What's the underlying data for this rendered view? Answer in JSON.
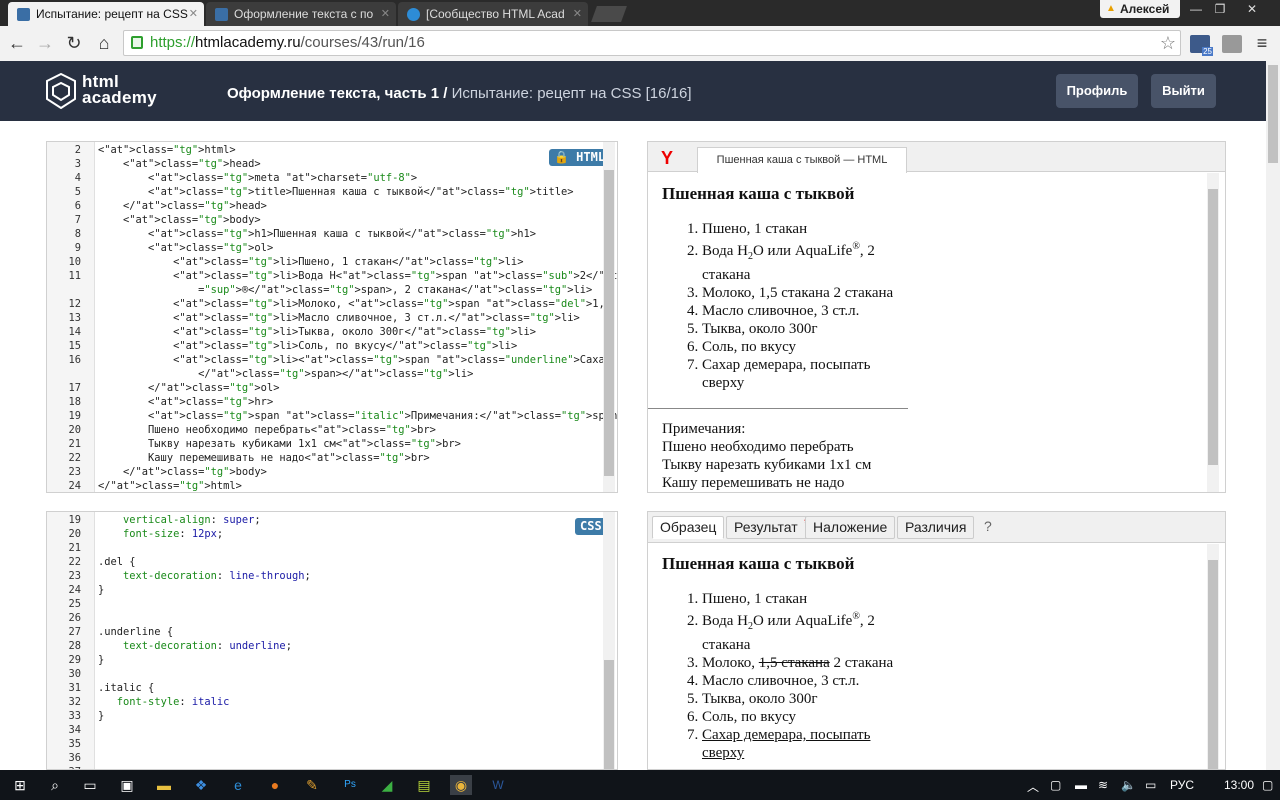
{
  "browser": {
    "tabs": [
      {
        "title": "Испытание: рецепт на CSS",
        "active": true
      },
      {
        "title": "Оформление текста с по",
        "active": false
      },
      {
        "title": "[Сообщество HTML Acad",
        "active": false
      }
    ],
    "user": "Алексей",
    "url_scheme": "https://",
    "url_host": "htmlacademy.ru",
    "url_path": "/courses/43/run/16",
    "mail_count": "25"
  },
  "header": {
    "logo_line1": "html",
    "logo_line2": "academy",
    "course": "Оформление текста, часть 1",
    "separator": "/",
    "task": "Испытание: рецепт на CSS",
    "progress": "[16/16]",
    "profile_label": "Профиль",
    "logout_label": "Выйти"
  },
  "html_editor": {
    "badge": "HTML",
    "lines": [
      {
        "n": "2",
        "code": "<html>"
      },
      {
        "n": "3",
        "code": "    <head>"
      },
      {
        "n": "4",
        "code": "        <meta charset=\"utf-8\">"
      },
      {
        "n": "5",
        "code": "        <title>Пшенная каша с тыквой</title>"
      },
      {
        "n": "6",
        "code": "    </head>"
      },
      {
        "n": "7",
        "code": "    <body>"
      },
      {
        "n": "8",
        "code": "        <h1>Пшенная каша с тыквой</h1>"
      },
      {
        "n": "9",
        "code": "        <ol>"
      },
      {
        "n": "10",
        "code": "            <li>Пшено, 1 стакан</li>"
      },
      {
        "n": "11",
        "code": "            <li>Вода H<span class=\"sub\">2</span>O или AquaLife<span class"
      },
      {
        "n": "",
        "code": "                =\"sup\">®</span>, 2 стакана</li>"
      },
      {
        "n": "12",
        "code": "            <li>Молоко, <span class=\"del\">1,5 стакана</span> 2 стакана</li>"
      },
      {
        "n": "13",
        "code": "            <li>Масло сливочное, 3 ст.л.</li>"
      },
      {
        "n": "14",
        "code": "            <li>Тыква, около 300г</li>"
      },
      {
        "n": "15",
        "code": "            <li>Соль, по вкусу</li>"
      },
      {
        "n": "16",
        "code": "            <li><span class=\"underline\">Сахар демерара, посыпать сверху"
      },
      {
        "n": "",
        "code": "                </span></li>"
      },
      {
        "n": "17",
        "code": "        </ol>"
      },
      {
        "n": "18",
        "code": "        <hr>"
      },
      {
        "n": "19",
        "code": "        <span class=\"italic\">Примечания:</span><br>"
      },
      {
        "n": "20",
        "code": "        Пшено необходимо перебрать<br>"
      },
      {
        "n": "21",
        "code": "        Тыкву нарезать кубиками 1x1 см<br>"
      },
      {
        "n": "22",
        "code": "        Кашу перемешивать не надо<br>"
      },
      {
        "n": "23",
        "code": "    </body>"
      },
      {
        "n": "24",
        "code": "</html>"
      }
    ]
  },
  "css_editor": {
    "badge": "CSS",
    "lines": [
      {
        "n": "19",
        "code": "    vertical-align: super;"
      },
      {
        "n": "20",
        "code": "    font-size: 12px;"
      },
      {
        "n": "21",
        "code": ""
      },
      {
        "n": "22",
        "code": ".del {"
      },
      {
        "n": "23",
        "code": "    text-decoration: line-through;"
      },
      {
        "n": "24",
        "code": "}"
      },
      {
        "n": "25",
        "code": ""
      },
      {
        "n": "26",
        "code": ""
      },
      {
        "n": "27",
        "code": ".underline {"
      },
      {
        "n": "28",
        "code": "    text-decoration: underline;"
      },
      {
        "n": "29",
        "code": "}"
      },
      {
        "n": "30",
        "code": ""
      },
      {
        "n": "31",
        "code": ".italic {"
      },
      {
        "n": "32",
        "code": "   font-style: italic"
      },
      {
        "n": "33",
        "code": "}"
      },
      {
        "n": "34",
        "code": ""
      },
      {
        "n": "35",
        "code": ""
      },
      {
        "n": "36",
        "code": ""
      },
      {
        "n": "37",
        "code": ""
      }
    ]
  },
  "preview": {
    "tab_title": "Пшенная каша с тыквой — HTML",
    "h1": "Пшенная каша с тыквой",
    "item1": "Пшено, 1 стакан",
    "item2_a": "Вода H",
    "item2_sub": "2",
    "item2_b": "O или AquaLife",
    "item2_sup": "®",
    "item2_c": ", 2 стакана",
    "item3_a": "Молоко, ",
    "item3_del": "1,5 стакана",
    "item3_b": " 2 стакана",
    "item4": "Масло сливочное, 3 ст.л.",
    "item5": "Тыква, около 300г",
    "item6": "Соль, по вкусу",
    "item7": "Сахар демерара, посыпать сверху",
    "notes_title": "Примечания:",
    "note1": "Пшено необходимо перебрать",
    "note2": "Тыкву нарезать кубиками 1x1 см",
    "note3": "Кашу перемешивать не надо"
  },
  "result_tabs": {
    "sample": "Образец",
    "result": "Результат",
    "result_marker": "*",
    "overlay": "Наложение",
    "diff": "Различия",
    "help": "?"
  },
  "taskbar": {
    "lang": "РУС",
    "time": "13:00"
  }
}
